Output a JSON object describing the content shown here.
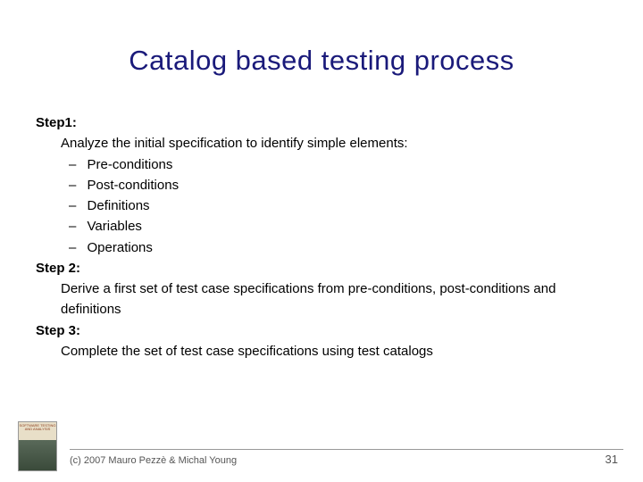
{
  "title": "Catalog based testing process",
  "steps": {
    "s1": {
      "label": "Step1:",
      "text": "Analyze the initial specification to identify simple elements:",
      "bullets": [
        "Pre-conditions",
        "Post-conditions",
        "Definitions",
        "Variables",
        "Operations"
      ]
    },
    "s2": {
      "label": "Step 2:",
      "text": "Derive a first set of test case specifications from pre-conditions, post-conditions and definitions"
    },
    "s3": {
      "label": "Step 3:",
      "text": "Complete the set of test case specifications using test catalogs"
    }
  },
  "footer": {
    "copyright": "(c) 2007 Mauro Pezzè & Michal Young",
    "page": "31",
    "book_top": "SOFTWARE TESTING AND ANALYSIS"
  }
}
